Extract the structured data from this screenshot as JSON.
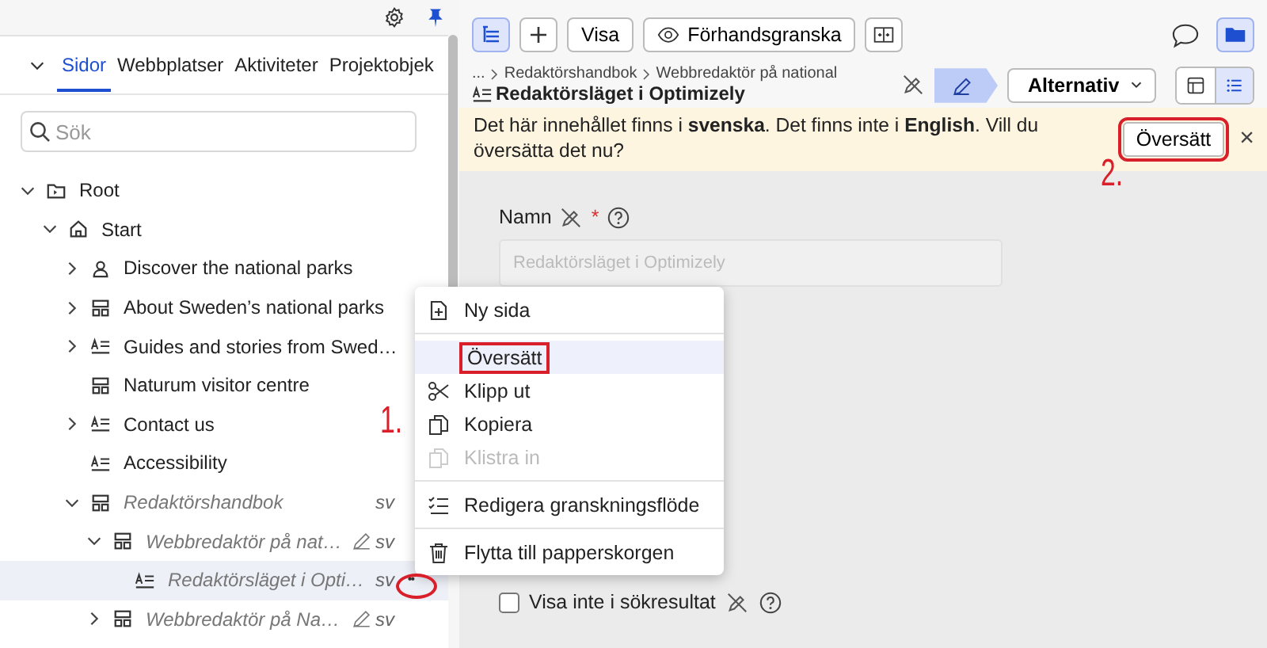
{
  "sidebar": {
    "tabs": [
      {
        "label": "Sidor",
        "selected": true
      },
      {
        "label": "Webbplatser",
        "selected": false
      },
      {
        "label": "Aktiviteter",
        "selected": false
      },
      {
        "label": "Projektobjek",
        "selected": false
      }
    ],
    "search": {
      "placeholder": "Sök"
    },
    "tree": [
      {
        "label": "Root",
        "kind": "folder",
        "expanded": true,
        "muted": false,
        "selected": false,
        "children": [
          {
            "label": "Start",
            "kind": "home",
            "expanded": true,
            "muted": false,
            "selected": false,
            "children": [
              {
                "label": "Discover the national parks",
                "kind": "person",
                "expanded": false,
                "muted": false,
                "selected": false
              },
              {
                "label": "About Sweden’s national parks",
                "kind": "layout",
                "expanded": false,
                "muted": false,
                "selected": false
              },
              {
                "label": "Guides and stories from Swed…",
                "kind": "article",
                "expanded": false,
                "muted": false,
                "selected": false
              },
              {
                "label": "Naturum visitor centre",
                "kind": "layout",
                "muted": false,
                "selected": false
              },
              {
                "label": "Contact us",
                "kind": "article",
                "expanded": false,
                "muted": false,
                "selected": false
              },
              {
                "label": "Accessibility",
                "kind": "article",
                "muted": false,
                "selected": false
              },
              {
                "label": "Redaktörshandbok",
                "kind": "layout",
                "expanded": true,
                "muted": true,
                "selected": false,
                "language": "sv",
                "children": [
                  {
                    "label": "Webbredaktör på nat…",
                    "kind": "layout",
                    "expanded": true,
                    "muted": true,
                    "selected": false,
                    "editing": true,
                    "language": "sv",
                    "children": [
                      {
                        "label": "Redaktörsläget i Opti…",
                        "kind": "article",
                        "muted": true,
                        "selected": true,
                        "language": "sv",
                        "menu": "••"
                      }
                    ]
                  },
                  {
                    "label": "Webbredaktör på Na…",
                    "kind": "layout",
                    "expanded": false,
                    "muted": true,
                    "selected": false,
                    "editing": true,
                    "language": "sv"
                  }
                ]
              }
            ]
          }
        ]
      }
    ]
  },
  "toolbar": {
    "buttons": [
      {
        "label": "Visa",
        "kind": "text"
      },
      {
        "label": "Förhandsgranska",
        "kind": "preview"
      }
    ]
  },
  "breadcrumb": [
    "...",
    "Redaktörshandbok",
    "Webbredaktör på national"
  ],
  "page_title": "Redaktörsläget i Optimizely",
  "options_button": "Alternativ",
  "banner": {
    "text": "Det här innehållet finns i **svenska**. Det finns inte i **English**. Vill du översätta det nu?",
    "button": "Översätt",
    "close": "×"
  },
  "form": {
    "name_label": "Namn",
    "required_mark": "*",
    "name_value": "Redaktörsläget i Optimizely",
    "checkbox_label": "Visa inte i sökresultat",
    "checkbox_checked": false
  },
  "context_menu": [
    [
      {
        "label": "Ny sida",
        "kind": "new-page",
        "selected": false,
        "disabled": false
      }
    ],
    [
      {
        "label": "Översätt",
        "kind": "none",
        "selected": true,
        "disabled": false
      },
      {
        "label": "Klipp ut",
        "kind": "cut",
        "selected": false,
        "disabled": false
      },
      {
        "label": "Kopiera",
        "kind": "copy",
        "selected": false,
        "disabled": false
      },
      {
        "label": "Klistra in",
        "kind": "paste",
        "selected": false,
        "disabled": true
      }
    ],
    [
      {
        "label": "Redigera granskningsflöde",
        "kind": "checklist",
        "selected": false,
        "disabled": false
      }
    ],
    [
      {
        "label": "Flytta till papperskorgen",
        "kind": "trash",
        "selected": false,
        "disabled": false
      }
    ]
  ],
  "annotations": [
    "1.",
    "2."
  ]
}
